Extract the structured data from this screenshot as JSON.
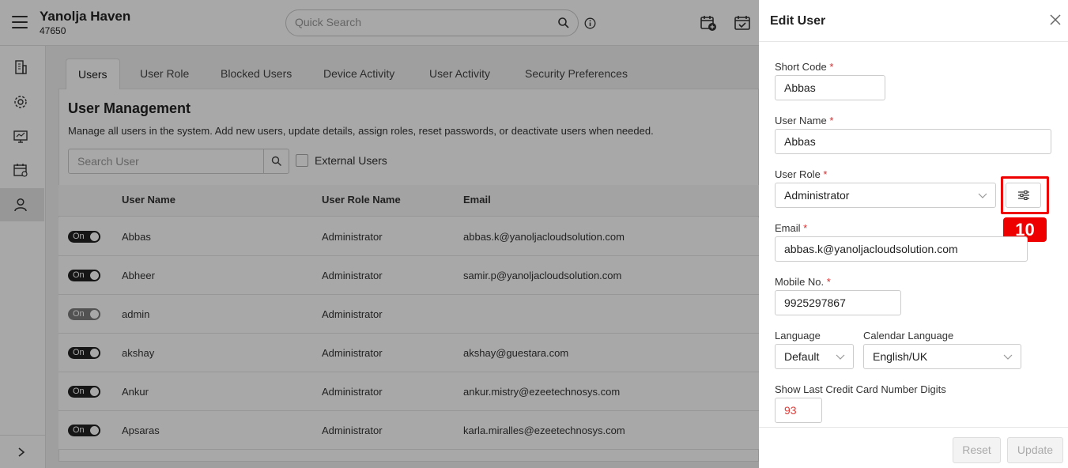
{
  "header": {
    "property_name": "Yanolja Haven",
    "property_code": "47650",
    "quick_search_placeholder": "Quick Search"
  },
  "sidebar": {
    "items": [
      {
        "icon": "building-icon"
      },
      {
        "icon": "gear-icon"
      },
      {
        "icon": "monitor-icon"
      },
      {
        "icon": "calendar-icon"
      },
      {
        "icon": "user-icon",
        "active": true
      }
    ]
  },
  "tabs": [
    "Users",
    "User Role",
    "Blocked Users",
    "Device Activity",
    "User Activity",
    "Security Preferences"
  ],
  "main": {
    "title": "User Management",
    "description": "Manage all users in the system. Add new users, update details, assign roles, reset passwords, or deactivate users when needed.",
    "search_placeholder": "Search User",
    "external_users_label": "External Users"
  },
  "table": {
    "columns": [
      "User Name",
      "User Role Name",
      "Email"
    ],
    "toggle_label": "On",
    "rows": [
      {
        "name": "Abbas",
        "role": "Administrator",
        "email": "abbas.k@yanoljacloudsolution.com",
        "active": true
      },
      {
        "name": "Abheer",
        "role": "Administrator",
        "email": "samir.p@yanoljacloudsolution.com",
        "active": true
      },
      {
        "name": "admin",
        "role": "Administrator",
        "email": "",
        "active": false
      },
      {
        "name": "akshay",
        "role": "Administrator",
        "email": "akshay@guestara.com",
        "active": true
      },
      {
        "name": "Ankur",
        "role": "Administrator",
        "email": "ankur.mistry@ezeetechnosys.com",
        "active": true
      },
      {
        "name": "Apsaras",
        "role": "Administrator",
        "email": "karla.miralles@ezeetechnosys.com",
        "active": true
      }
    ]
  },
  "drawer": {
    "title": "Edit User",
    "short_code_label": "Short Code",
    "short_code": "Abbas",
    "user_name_label": "User Name",
    "user_name": "Abbas",
    "user_role_label": "User Role",
    "user_role": "Administrator",
    "email_label": "Email",
    "email": "abbas.k@yanoljacloudsolution.com",
    "mobile_label": "Mobile No.",
    "mobile": "9925297867",
    "language_label": "Language",
    "language": "Default",
    "calendar_language_label": "Calendar Language",
    "calendar_language": "English/UK",
    "credit_card_label": "Show Last Credit Card Number Digits",
    "credit_card_digits": "93",
    "required_mark": "*",
    "reset_label": "Reset",
    "update_label": "Update"
  },
  "annotation": {
    "badge": "10",
    "color": "#ee0000"
  }
}
